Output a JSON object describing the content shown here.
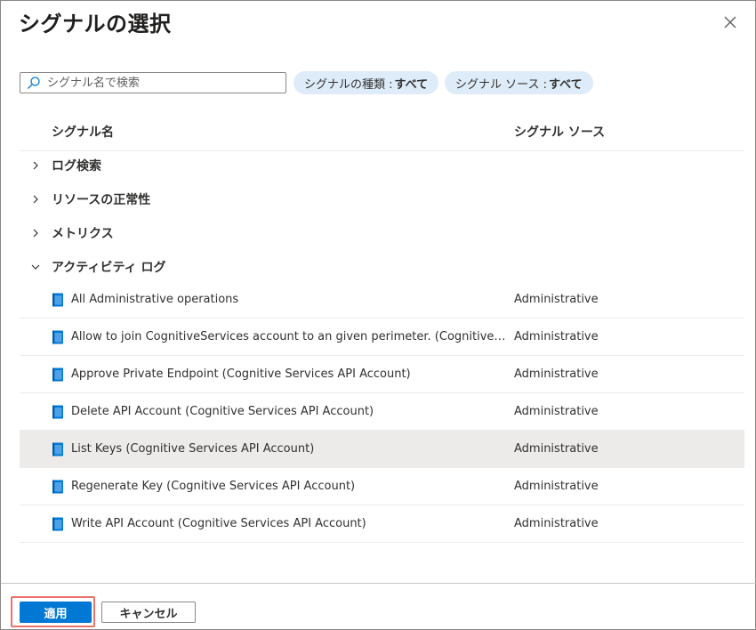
{
  "header": {
    "title": "シグナルの選択"
  },
  "search": {
    "placeholder": "シグナル名で検索",
    "value": ""
  },
  "filters": {
    "type_label": "シグナルの種類 :",
    "type_value": "すべて",
    "source_label": "シグナル ソース :",
    "source_value": "すべて"
  },
  "columns": {
    "name": "シグナル名",
    "source": "シグナル ソース"
  },
  "groups": [
    {
      "label": "ログ検索",
      "expanded": false
    },
    {
      "label": "リソースの正常性",
      "expanded": false
    },
    {
      "label": "メトリクス",
      "expanded": false
    },
    {
      "label": "アクティビティ ログ",
      "expanded": true
    }
  ],
  "signals": [
    {
      "name": "All Administrative operations",
      "source": "Administrative",
      "selected": false
    },
    {
      "name": "Allow to join CognitiveServices account to an given perimeter. (Cognitive Services API Account)",
      "source": "Administrative",
      "selected": false
    },
    {
      "name": "Approve Private Endpoint (Cognitive Services API Account)",
      "source": "Administrative",
      "selected": false
    },
    {
      "name": "Delete API Account (Cognitive Services API Account)",
      "source": "Administrative",
      "selected": false
    },
    {
      "name": "List Keys (Cognitive Services API Account)",
      "source": "Administrative",
      "selected": true
    },
    {
      "name": "Regenerate Key (Cognitive Services API Account)",
      "source": "Administrative",
      "selected": false
    },
    {
      "name": "Write API Account (Cognitive Services API Account)",
      "source": "Administrative",
      "selected": false
    }
  ],
  "footer": {
    "apply_label": "適用",
    "cancel_label": "キャンセル"
  },
  "colors": {
    "accent": "#0078d4",
    "pill_bg": "#deecf9",
    "selected_row": "#edebe9",
    "doc_icon": "#0078d4",
    "highlight": "#e8726c"
  }
}
